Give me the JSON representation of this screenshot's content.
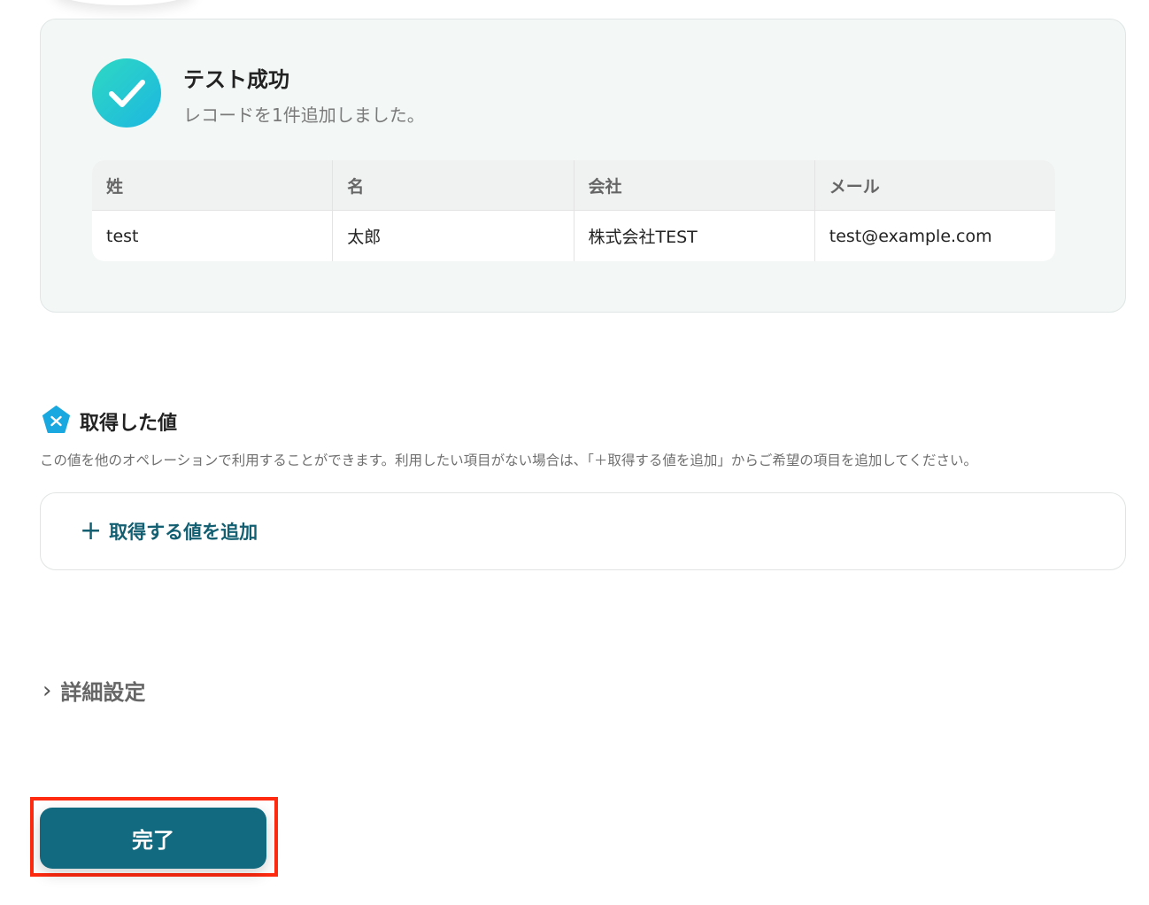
{
  "success": {
    "title": "テスト成功",
    "subtitle": "レコードを1件追加しました。",
    "table": {
      "headers": [
        "姓",
        "名",
        "会社",
        "メール"
      ],
      "rows": [
        [
          "test",
          "太郎",
          "株式会社TEST",
          "test@example.com"
        ]
      ]
    },
    "icon": "check-circle-icon",
    "gradient_colors": [
      "#2ed8c3",
      "#1db7e0"
    ]
  },
  "acquired": {
    "title": "取得した値",
    "description": "この値を他のオペレーションで利用することができます。利用したい項目がない場合は、「＋取得する値を追加」からご希望の項目を追加してください。",
    "add_label": "取得する値を追加",
    "icon": "variable-icon"
  },
  "details": {
    "label": "詳細設定"
  },
  "footer": {
    "done_label": "完了",
    "done_color": "#126a80",
    "highlight_color": "#ff2a10"
  }
}
